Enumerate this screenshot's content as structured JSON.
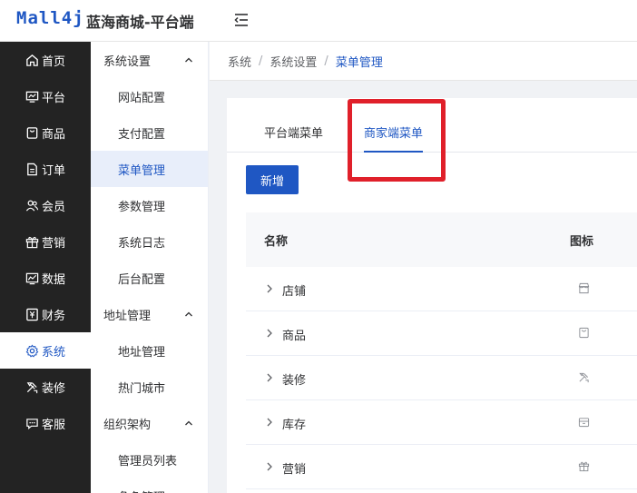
{
  "header": {
    "logo_text": "Mall4j",
    "app_title": "蓝海商城-平台端"
  },
  "sidebar": {
    "items": [
      {
        "label": "首页",
        "icon": "home-icon"
      },
      {
        "label": "平台",
        "icon": "monitor-icon"
      },
      {
        "label": "商品",
        "icon": "bag-icon"
      },
      {
        "label": "订单",
        "icon": "document-icon"
      },
      {
        "label": "会员",
        "icon": "users-icon"
      },
      {
        "label": "营销",
        "icon": "gift-icon"
      },
      {
        "label": "数据",
        "icon": "chart-icon"
      },
      {
        "label": "财务",
        "icon": "finance-icon"
      },
      {
        "label": "系统",
        "icon": "gear-icon",
        "active": true
      },
      {
        "label": "装修",
        "icon": "brush-icon"
      },
      {
        "label": "客服",
        "icon": "chat-icon"
      }
    ]
  },
  "subnav": {
    "groups": [
      {
        "label": "系统设置",
        "items": [
          "网站配置",
          "支付配置",
          "菜单管理",
          "参数管理",
          "系统日志",
          "后台配置"
        ]
      },
      {
        "label": "地址管理",
        "items": [
          "地址管理",
          "热门城市"
        ]
      },
      {
        "label": "组织架构",
        "items": [
          "管理员列表",
          "角色管理"
        ]
      }
    ],
    "active_item": "菜单管理"
  },
  "breadcrumb": [
    "系统",
    "系统设置",
    "菜单管理"
  ],
  "breadcrumb_sep": "/",
  "tabs": [
    {
      "label": "平台端菜单",
      "active": false
    },
    {
      "label": "商家端菜单",
      "active": true
    }
  ],
  "add_button_label": "新增",
  "table": {
    "columns": [
      "名称",
      "图标"
    ],
    "rows": [
      {
        "name": "店铺",
        "icon": "shop-icon"
      },
      {
        "name": "商品",
        "icon": "bag-icon"
      },
      {
        "name": "装修",
        "icon": "brush-icon"
      },
      {
        "name": "库存",
        "icon": "box-icon"
      },
      {
        "name": "营销",
        "icon": "gift-icon"
      }
    ]
  },
  "colors": {
    "accent": "#1f57c3",
    "sidebar_bg": "#232323",
    "highlight": "#e0202a"
  }
}
